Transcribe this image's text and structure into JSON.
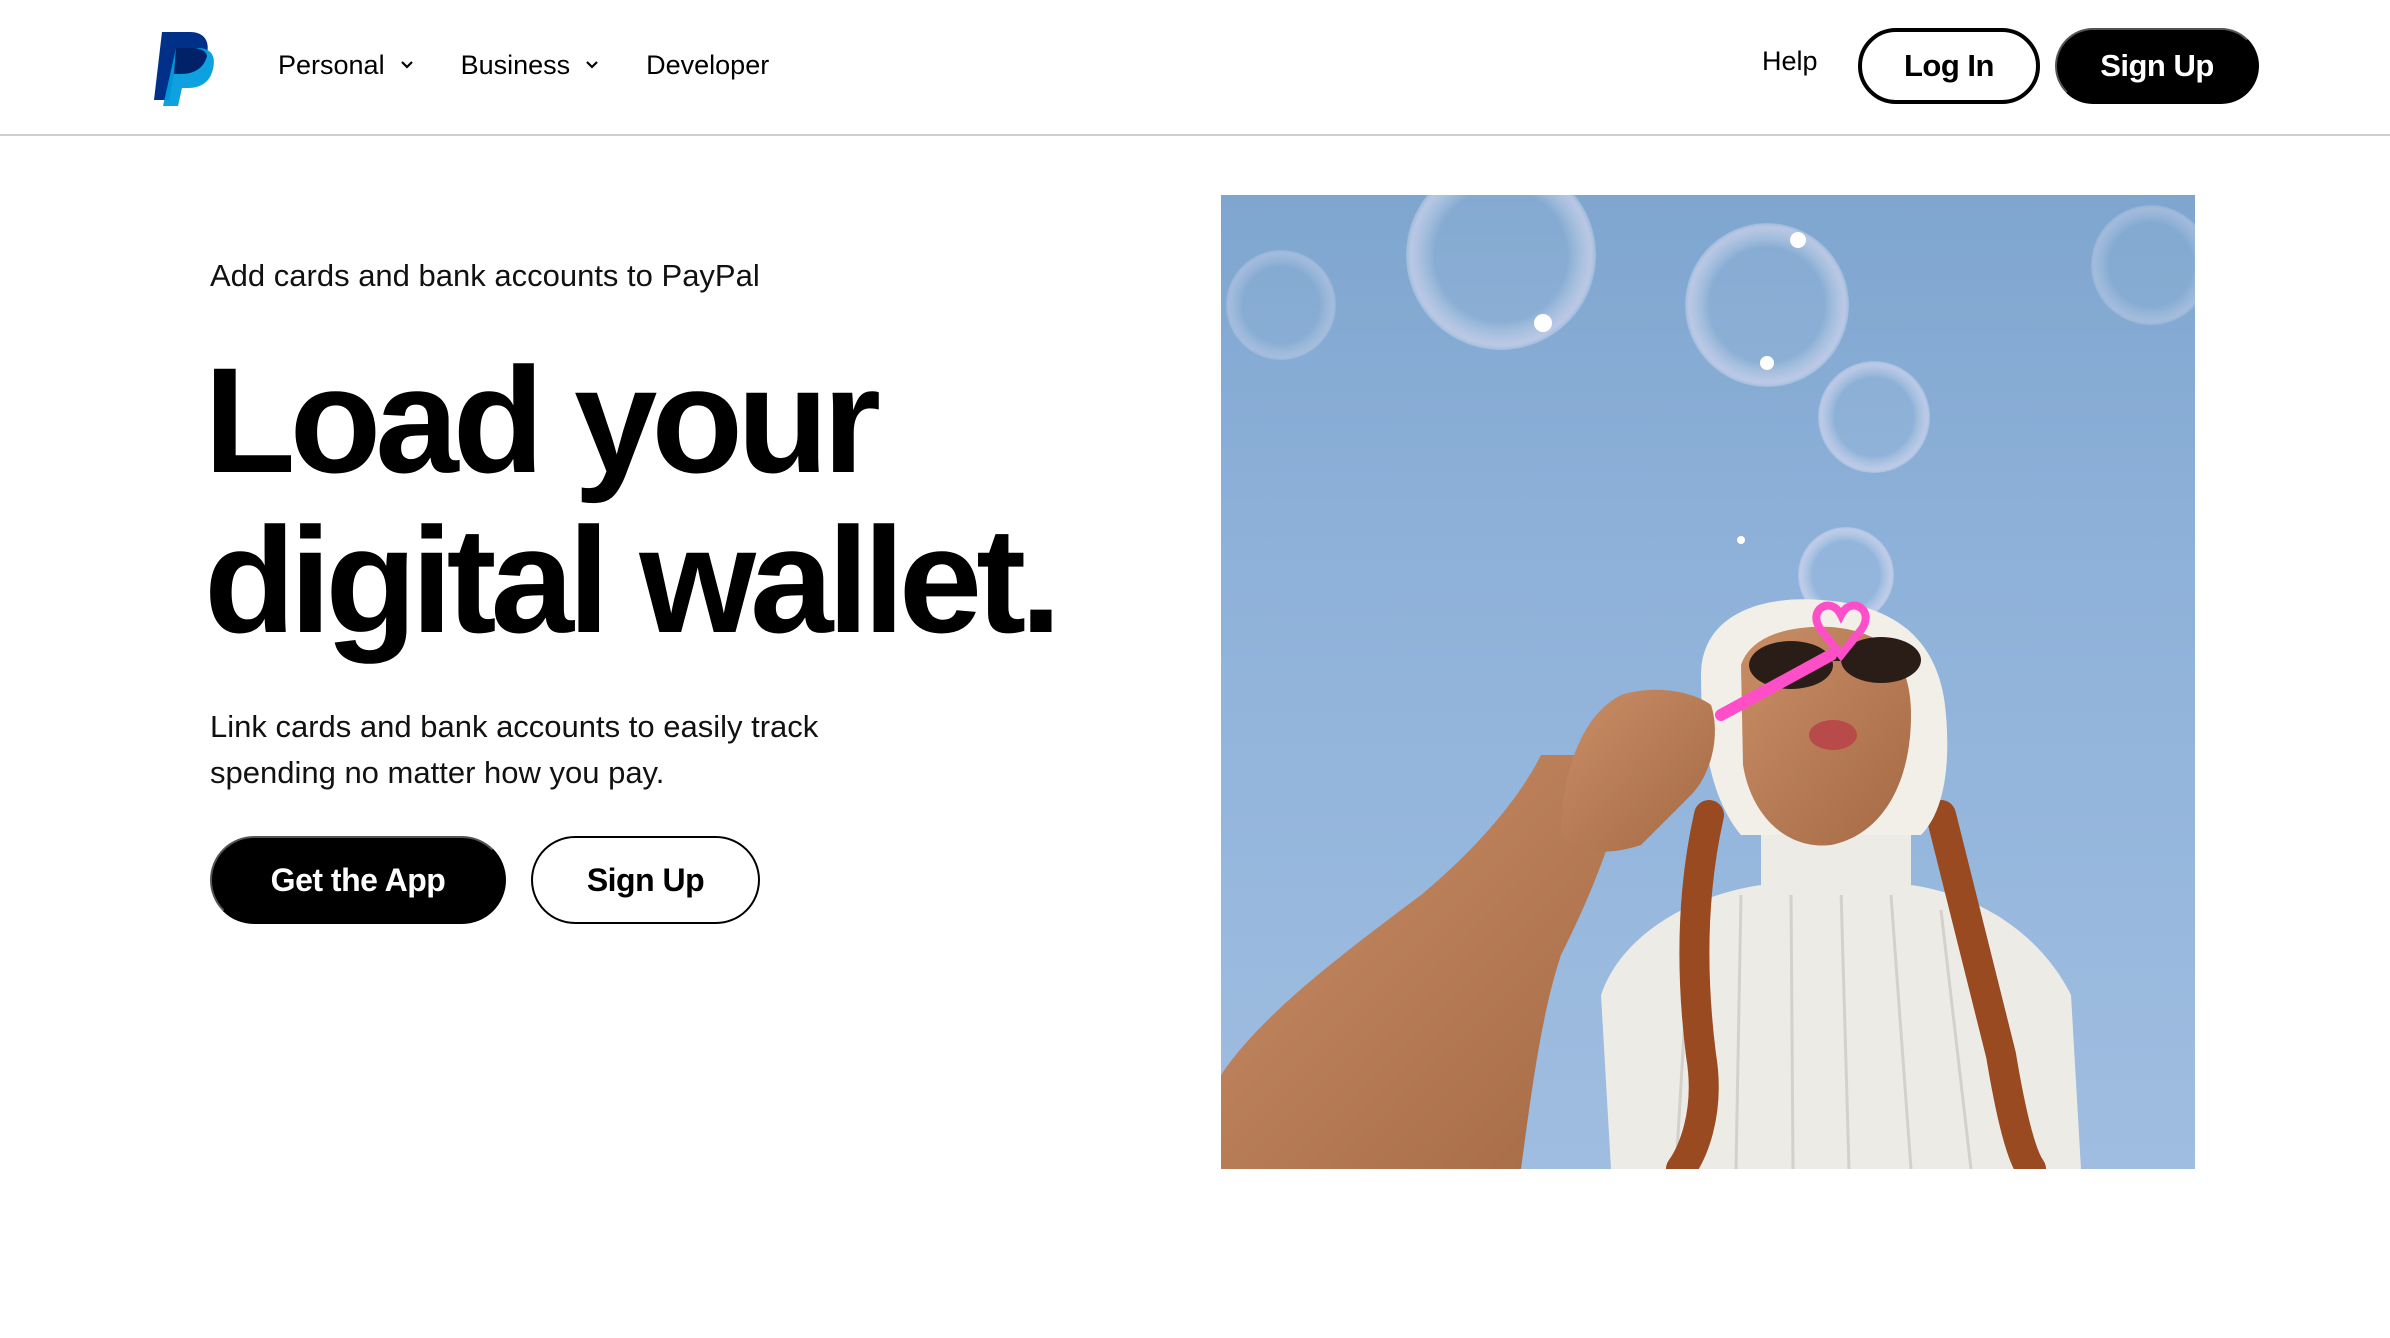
{
  "header": {
    "logo": "paypal-logo",
    "nav": [
      {
        "label": "Personal",
        "dropdown": true
      },
      {
        "label": "Business",
        "dropdown": true
      },
      {
        "label": "Developer",
        "dropdown": false
      }
    ],
    "help_label": "Help",
    "login_label": "Log In",
    "signup_label": "Sign Up"
  },
  "hero": {
    "eyebrow": "Add cards and bank accounts to PayPal",
    "headline_line1": "Load your",
    "headline_line2": "digital wallet.",
    "body": "Link cards and bank accounts to easily track spending no matter how you pay.",
    "primary_cta": "Get the App",
    "secondary_cta": "Sign Up",
    "image": "photo-woman-blowing-bubbles"
  },
  "colors": {
    "brand_dark_blue": "#003087",
    "brand_light_blue": "#009cde",
    "button_black": "#000000",
    "sky_blue": "#8fb2da"
  }
}
